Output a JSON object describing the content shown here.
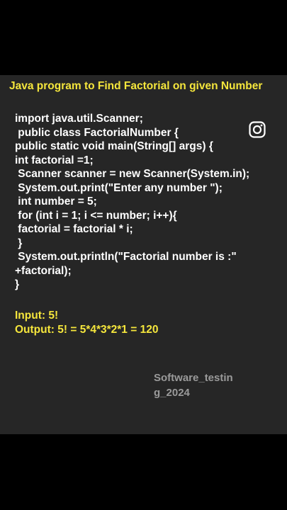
{
  "post": {
    "title": "Java program to Find Factorial on given Number",
    "code_lines": [
      "import java.util.Scanner;",
      " public class FactorialNumber {",
      "public static void main(String[] args) {",
      "int factorial =1;",
      " Scanner scanner = new Scanner(System.in);",
      " System.out.print(\"Enter any number \");",
      " int number = 5;",
      " for (int i = 1; i <= number; i++){",
      " factorial = factorial * i;",
      " }",
      " System.out.println(\"Factorial number is :\"",
      "+factorial);",
      "}"
    ],
    "input_line": "Input: 5!",
    "output_line": "Output: 5! = 5*4*3*2*1 = 120",
    "watermark_line1": "Software_testin",
    "watermark_line2": "g_2024"
  },
  "icons": {
    "social": "instagram-icon"
  },
  "colors": {
    "background": "#000000",
    "panel": "#262626",
    "accent_yellow": "#f5e63c",
    "code_text": "#ffffff",
    "watermark": "#9a9a9a"
  }
}
